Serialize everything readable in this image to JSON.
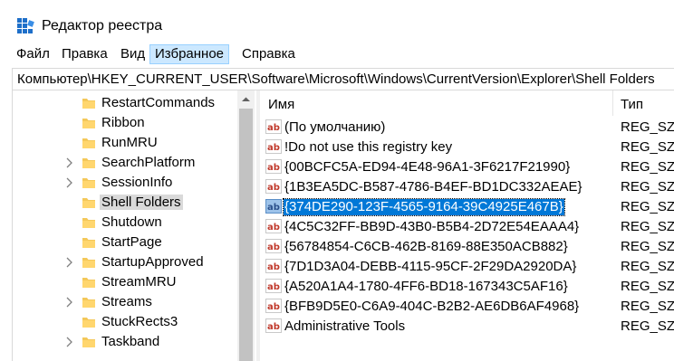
{
  "window": {
    "title": "Редактор реестра"
  },
  "menu": [
    "Файл",
    "Правка",
    "Вид",
    "Избранное",
    "Справка"
  ],
  "address": "Компьютер\\HKEY_CURRENT_USER\\Software\\Microsoft\\Windows\\CurrentVersion\\Explorer\\Shell Folders",
  "tree": {
    "items": [
      {
        "label": "RestartCommands"
      },
      {
        "label": "Ribbon"
      },
      {
        "label": "RunMRU"
      },
      {
        "label": "SearchPlatform"
      },
      {
        "label": "SessionInfo"
      },
      {
        "label": "Shell Folders"
      },
      {
        "label": "Shutdown"
      },
      {
        "label": "StartPage"
      },
      {
        "label": "StartupApproved"
      },
      {
        "label": "StreamMRU"
      },
      {
        "label": "Streams"
      },
      {
        "label": "StuckRects3"
      },
      {
        "label": "Taskband"
      }
    ]
  },
  "list": {
    "headers": {
      "name": "Имя",
      "type": "Тип"
    },
    "rows": [
      {
        "name": "(По умолчанию)",
        "type": "REG_SZ"
      },
      {
        "name": "!Do not use this registry key",
        "type": "REG_SZ"
      },
      {
        "name": "{00BCFC5A-ED94-4E48-96A1-3F6217F21990}",
        "type": "REG_SZ"
      },
      {
        "name": "{1B3EA5DC-B587-4786-B4EF-BD1DC332AEAE}",
        "type": "REG_SZ"
      },
      {
        "name": "{374DE290-123F-4565-9164-39C4925E467B}",
        "type": "REG_SZ"
      },
      {
        "name": "{4C5C32FF-BB9D-43B0-B5B4-2D72E54EAAA4}",
        "type": "REG_SZ"
      },
      {
        "name": "{56784854-C6CB-462B-8169-88E350ACB882}",
        "type": "REG_SZ"
      },
      {
        "name": "{7D1D3A04-DEBB-4115-95CF-2F29DA2920DA}",
        "type": "REG_SZ"
      },
      {
        "name": "{A520A1A4-1780-4FF6-BD18-167343C5AF16}",
        "type": "REG_SZ"
      },
      {
        "name": "{BFB9D5E0-C6A9-404C-B2B2-AE6DB6AF4968}",
        "type": "REG_SZ"
      },
      {
        "name": "Administrative Tools",
        "type": "REG_SZ"
      }
    ]
  },
  "colors": {
    "selection": "#0078d7",
    "menu_highlight": "#cce8ff",
    "folder": "#f4c85a"
  },
  "icons": {
    "app": "regedit-icon",
    "folder": "folder-icon",
    "value": "string-value-ab-icon"
  }
}
